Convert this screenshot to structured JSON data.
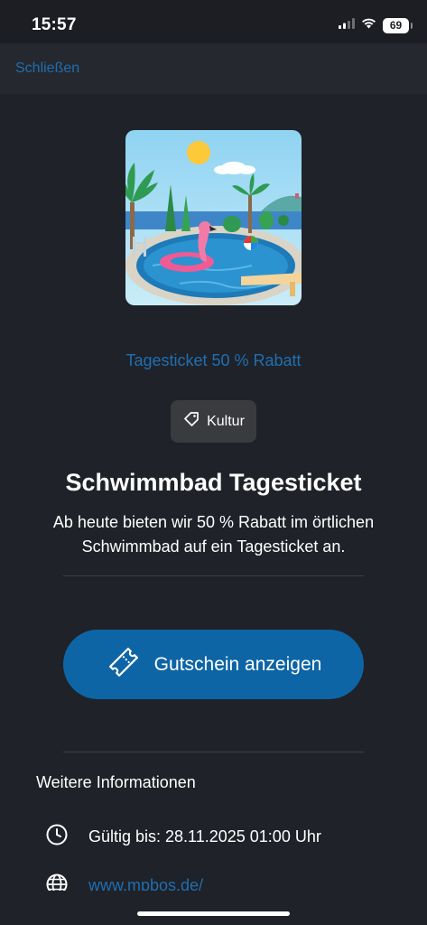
{
  "status_bar": {
    "time": "15:57",
    "battery": "69"
  },
  "nav": {
    "close_label": "Schließen"
  },
  "hero": {
    "image": "swimming-pool-illustration"
  },
  "offer": {
    "category": "Tagesticket 50 % Rabatt",
    "tag": "Kultur",
    "title": "Schwimmbad Tagesticket",
    "description": "Ab heute bieten wir 50 % Rabatt im örtlichen Schwimmbad auf ein Tagesticket an."
  },
  "actions": {
    "show_voucher_label": "Gutschein anzeigen"
  },
  "info": {
    "heading": "Weitere Informationen",
    "valid_until": "Gültig bis: 28.11.2025 01:00 Uhr",
    "website": "www.mpbos.de/"
  },
  "colors": {
    "background": "#1f2228",
    "accent": "#1f6fb2",
    "button": "#0e65a6"
  }
}
